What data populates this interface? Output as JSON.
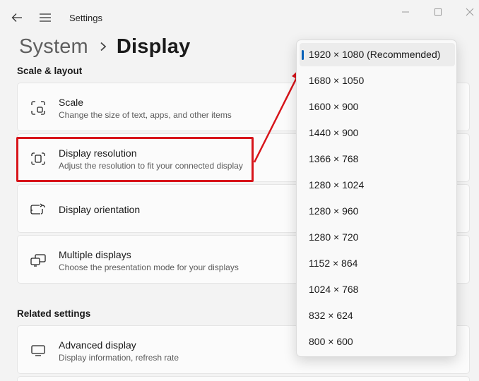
{
  "window": {
    "title": "Settings",
    "back_icon": "back-arrow-icon",
    "menu_icon": "hamburger-menu-icon"
  },
  "breadcrumb": {
    "parent": "System",
    "current": "Display"
  },
  "sections": {
    "scale_layout": "Scale & layout",
    "related": "Related settings"
  },
  "cards": {
    "scale": {
      "title": "Scale",
      "subtitle": "Change the size of text, apps, and other items",
      "icon": "scale-icon"
    },
    "resolution": {
      "title": "Display resolution",
      "subtitle": "Adjust the resolution to fit your connected display",
      "icon": "resolution-icon"
    },
    "orientation": {
      "title": "Display orientation",
      "icon": "orientation-icon"
    },
    "multiple": {
      "title": "Multiple displays",
      "subtitle": "Choose the presentation mode for your displays",
      "icon": "multiple-displays-icon"
    },
    "advanced": {
      "title": "Advanced display",
      "subtitle": "Display information, refresh rate",
      "icon": "monitor-icon"
    }
  },
  "resolution_dropdown": {
    "selected": "1920 × 1080 (Recommended)",
    "options": [
      "1920 × 1080 (Recommended)",
      "1680 × 1050",
      "1600 × 900",
      "1440 × 900",
      "1366 × 768",
      "1280 × 1024",
      "1280 × 960",
      "1280 × 720",
      "1152 × 864",
      "1024 × 768",
      "832 × 624",
      "800 × 600"
    ]
  },
  "colors": {
    "accent": "#005fb8",
    "annotation_red": "#d7141a",
    "background": "#f3f3f3"
  }
}
